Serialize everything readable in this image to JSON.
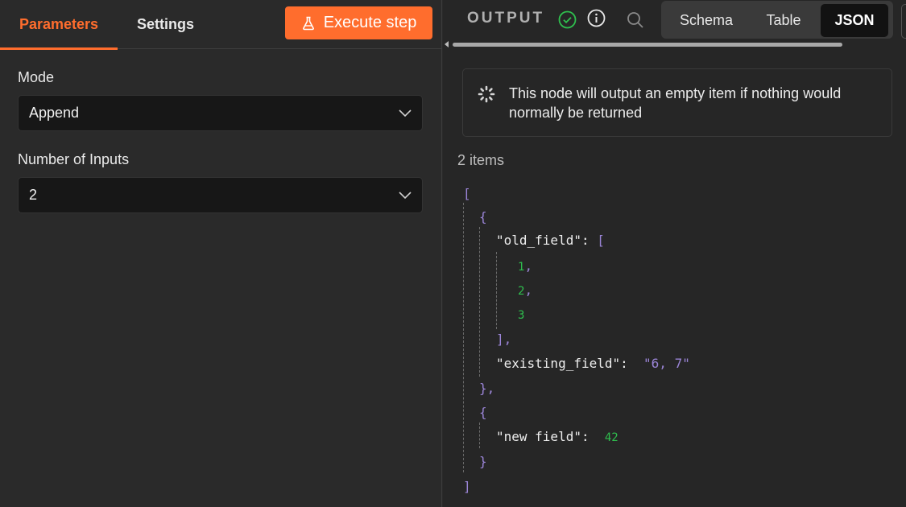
{
  "left_tabs": {
    "parameters": "Parameters",
    "settings": "Settings"
  },
  "execute_button": {
    "label": "Execute step",
    "icon": "flask-icon"
  },
  "fields": {
    "mode": {
      "label": "Mode",
      "value": "Append"
    },
    "number_of_inputs": {
      "label": "Number of Inputs",
      "value": "2"
    }
  },
  "output": {
    "title": "OUTPUT",
    "views": {
      "schema": "Schema",
      "table": "Table",
      "json": "JSON"
    },
    "active_view": "JSON",
    "notice": "This node will output an empty item if nothing would normally be returned",
    "items_count": "2 items"
  },
  "json_view": {
    "open_root": "[",
    "close_root": "]",
    "item1_open": "{",
    "item1_close": "},",
    "key_old_field": "\"old_field\"",
    "colon1": ": ",
    "arr_open": "[",
    "arr_vals": [
      "1",
      "2",
      "3"
    ],
    "arr_close": "],",
    "key_existing": "\"existing_field\"",
    "colon2": ":  ",
    "existing_value": "\"6, 7\"",
    "item2_open": "{",
    "item2_close": "}",
    "key_new": "\"new field\"",
    "colon3": ":  ",
    "new_value": "42"
  },
  "colors": {
    "accent": "#ff6d2d",
    "success": "#2fbf4e",
    "json_punct": "#9a84d6"
  }
}
